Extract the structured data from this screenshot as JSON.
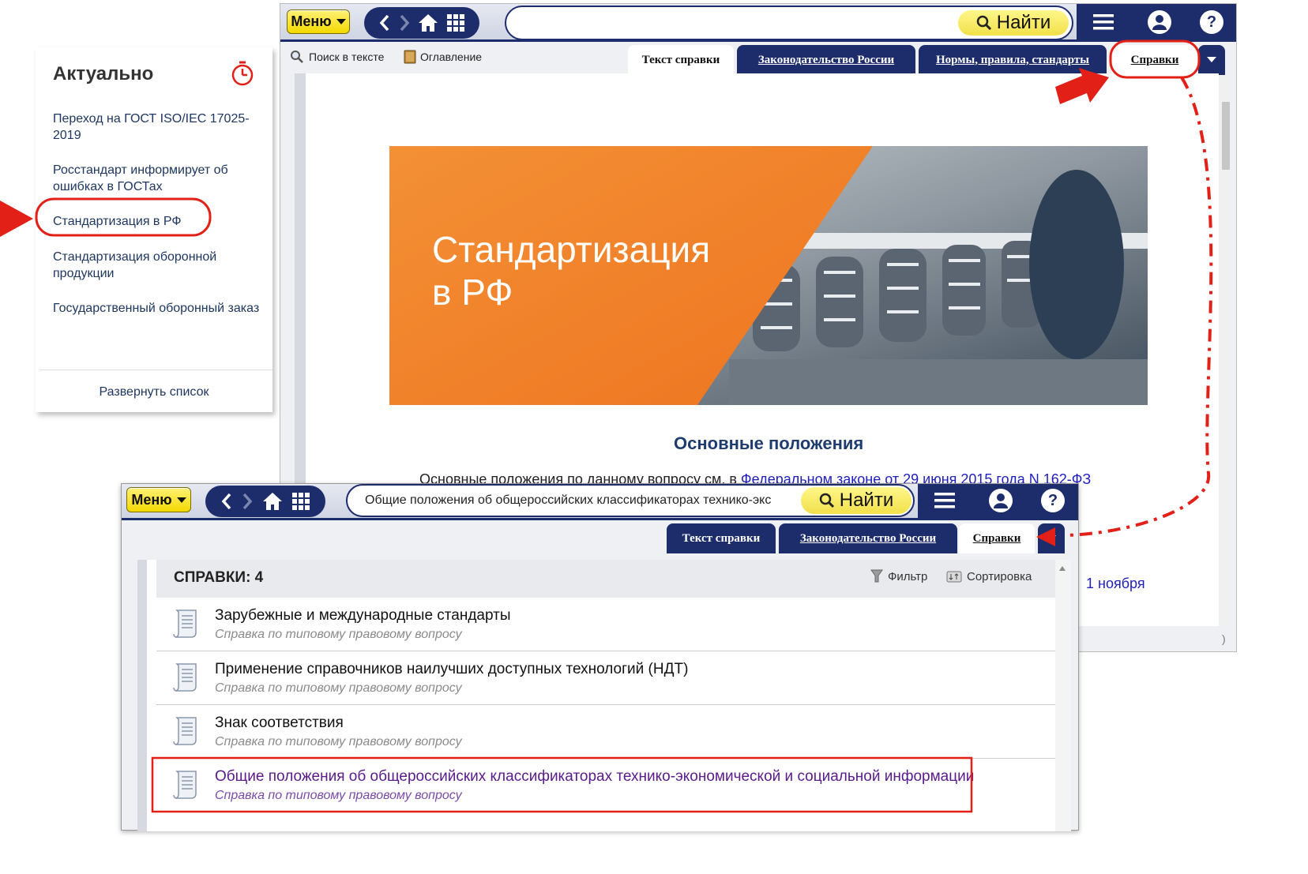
{
  "colors": {
    "brand_dark": "#1d2c6b",
    "accent_yellow": "#f3d900",
    "highlight_red": "#e32017",
    "banner_orange": "#f07a22",
    "link_blue": "#1f1fbf",
    "visited_purple": "#5a1a8a"
  },
  "left_panel": {
    "title": "Актуально",
    "items": [
      "Переход на ГОСТ ISO/IEC 17025-2019",
      "Росстандарт информирует об ошибках в ГОСТах",
      "Стандартизация в РФ",
      "Стандартизация оборонной продукции",
      "Государственный оборонный заказ"
    ],
    "expand": "Развернуть список"
  },
  "back_window": {
    "menu_label": "Меню",
    "find_label": "Найти",
    "search_value": "",
    "tools": {
      "search_in_text": "Поиск в тексте",
      "contents": "Оглавление"
    },
    "tabs": [
      "Текст справки",
      "Законодательство России",
      "Нормы, правила, стандарты",
      "Справки"
    ],
    "banner_text_line1": "Стандартизация",
    "banner_text_line2": "в РФ",
    "section_heading": "Основные положения",
    "para_prefix": "Основные положения по данному вопросу см. в ",
    "para_link": "Федеральном законе от 29 июня 2015 года N 162-ФЗ",
    "hidden_fragment": "1 ноября",
    "status_char": ")"
  },
  "front_window": {
    "menu_label": "Меню",
    "find_label": "Найти",
    "search_value": "Общие положения об общероссийских классификаторах технико-экс",
    "tabs": [
      "Текст справки",
      "Законодательство России",
      "Справки"
    ],
    "list_title": "СПРАВКИ: 4",
    "filter": "Фильтр",
    "sort": "Сортировка",
    "rows": [
      {
        "title": "Зарубежные и международные стандарты",
        "subtitle": "Справка по типовому правовому вопросу"
      },
      {
        "title": "Применение справочников наилучших доступных технологий (НДТ)",
        "subtitle": "Справка по типовому правовому вопросу"
      },
      {
        "title": "Знак соответствия",
        "subtitle": "Справка по типовому правовому вопросу"
      },
      {
        "title": "Общие положения об общероссийских классификаторах технико-экономической и социальной информации",
        "subtitle": "Справка по типовому правовому вопросу"
      }
    ]
  },
  "icons": [
    "search-icon",
    "book-icon",
    "back-icon",
    "forward-icon",
    "home-icon",
    "grid-icon",
    "hamburger-icon",
    "user-icon",
    "help-icon",
    "timer-icon",
    "filter-icon",
    "sort-icon",
    "document-icon",
    "chevron-down-icon"
  ]
}
